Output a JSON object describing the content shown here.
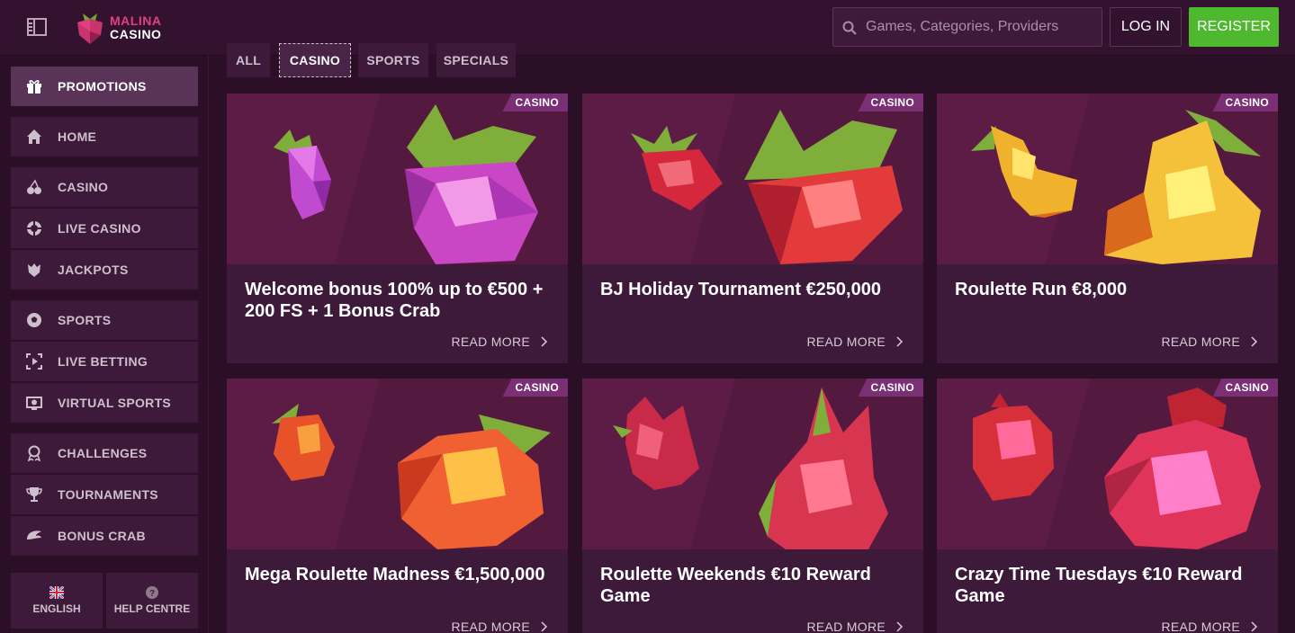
{
  "header": {
    "logo_line1": "MALINA",
    "logo_line2": "CASINO",
    "search_placeholder": "Games, Categories, Providers",
    "login_label": "LOG IN",
    "register_label": "REGISTER"
  },
  "sidebar": {
    "items": [
      {
        "label": "PROMOTIONS",
        "icon": "gift-icon"
      },
      {
        "label": "HOME",
        "icon": "home-icon"
      },
      {
        "label": "CASINO",
        "icon": "cherries-icon"
      },
      {
        "label": "LIVE CASINO",
        "icon": "chip-icon"
      },
      {
        "label": "JACKPOTS",
        "icon": "jackpot-icon"
      },
      {
        "label": "SPORTS",
        "icon": "soccer-ball-icon"
      },
      {
        "label": "LIVE BETTING",
        "icon": "live-betting-icon"
      },
      {
        "label": "VIRTUAL SPORTS",
        "icon": "virtual-sports-icon"
      },
      {
        "label": "CHALLENGES",
        "icon": "medal-icon"
      },
      {
        "label": "TOURNAMENTS",
        "icon": "trophy-icon"
      },
      {
        "label": "BONUS CRAB",
        "icon": "crab-claw-icon"
      }
    ],
    "language_label": "ENGLISH",
    "help_label": "HELP CENTRE"
  },
  "filters": {
    "tabs": [
      "ALL",
      "CASINO",
      "SPORTS",
      "SPECIALS"
    ],
    "active": "CASINO"
  },
  "promotions": [
    {
      "badge": "CASINO",
      "title": "Welcome bonus 100% up to €500 + 200 FS + 1 Bonus Crab",
      "cta": "READ MORE"
    },
    {
      "badge": "CASINO",
      "title": "BJ Holiday Tournament €250,000",
      "cta": "READ MORE"
    },
    {
      "badge": "CASINO",
      "title": "Roulette Run €8,000",
      "cta": "READ MORE"
    },
    {
      "badge": "CASINO",
      "title": "Mega Roulette Madness €1,500,000",
      "cta": "READ MORE"
    },
    {
      "badge": "CASINO",
      "title": "Roulette Weekends €10 Reward Game",
      "cta": "READ MORE"
    },
    {
      "badge": "CASINO",
      "title": "Crazy Time Tuesdays €10 Reward Game",
      "cta": "READ MORE"
    }
  ],
  "colors": {
    "background": "#2a0f27",
    "header": "#33122f",
    "panel": "#3d1a3a",
    "brand_pink": "#e0407e",
    "register_green": "#4eb82e",
    "badge_purple": "#7b2f75"
  }
}
